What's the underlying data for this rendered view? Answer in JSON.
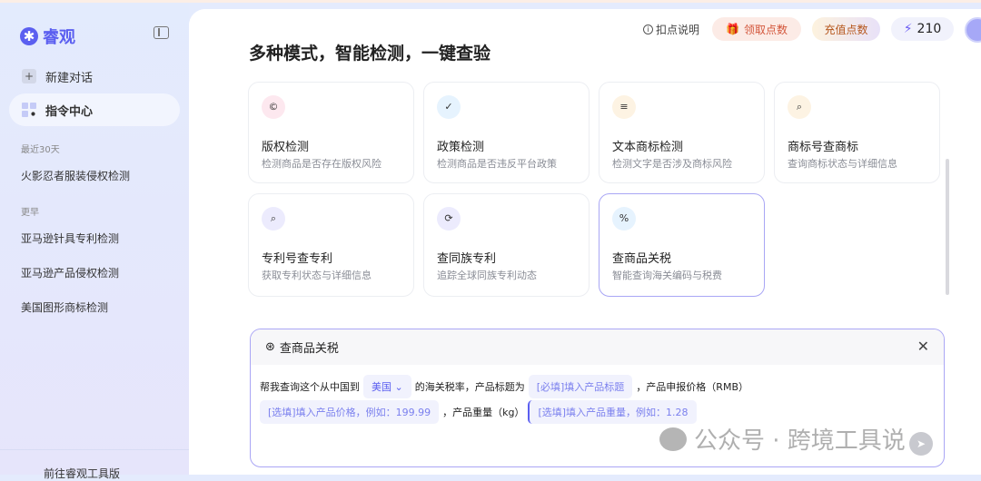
{
  "app": {
    "name": "睿观"
  },
  "sidebar": {
    "new_chat": "新建对话",
    "command_center": "指令中心",
    "recent_label": "最近30天",
    "recent": [
      "火影忍者服装侵权检测"
    ],
    "earlier_label": "更早",
    "earlier": [
      "亚马逊针具专利检测",
      "亚马逊产品侵权检测",
      "美国图形商标检测"
    ],
    "bottom": "前往睿观工具版"
  },
  "header": {
    "info": "扣点说明",
    "claim": "领取点数",
    "recharge": "充值点数",
    "points": "210"
  },
  "main": {
    "heading": "多种模式，智能检测，一键查验",
    "cards": [
      {
        "title": "版权检测",
        "desc": "检测商品是否存在版权风险",
        "icon": "copyright-icon",
        "color": "#fde8ef"
      },
      {
        "title": "政策检测",
        "desc": "检测商品是否违反平台政策",
        "icon": "shield-check-icon",
        "color": "#e6f3fe"
      },
      {
        "title": "文本商标检测",
        "desc": "检测文字是否涉及商标风险",
        "icon": "document-icon",
        "color": "#fdf3e3"
      },
      {
        "title": "商标号查商标",
        "desc": "查询商标状态与详细信息",
        "icon": "search-icon",
        "color": "#fdf3e3"
      },
      {
        "title": "专利号查专利",
        "desc": "获取专利状态与详细信息",
        "icon": "search-icon",
        "color": "#ecebfd"
      },
      {
        "title": "查同族专利",
        "desc": "追踪全球同族专利动态",
        "icon": "sync-icon",
        "color": "#ecebfd"
      },
      {
        "title": "查商品关税",
        "desc": "智能查询海关编码与税费",
        "icon": "tax-icon",
        "color": "#e6f3fe"
      }
    ]
  },
  "dialog": {
    "title": "查商品关税",
    "t1": "帮我查询这个从中国到",
    "country": "美国",
    "t2": "的海关税率，产品标题为",
    "title_ph": "[必填]填入产品标题",
    "t3": "，产品申报价格（RMB）",
    "price_ph": "[选填]填入产品价格，例如：199.99",
    "t4": "，产品重量（kg）",
    "weight_ph": "[选填]填入产品重量，例如：1.28"
  },
  "watermark": "公众号 · 跨境工具说"
}
